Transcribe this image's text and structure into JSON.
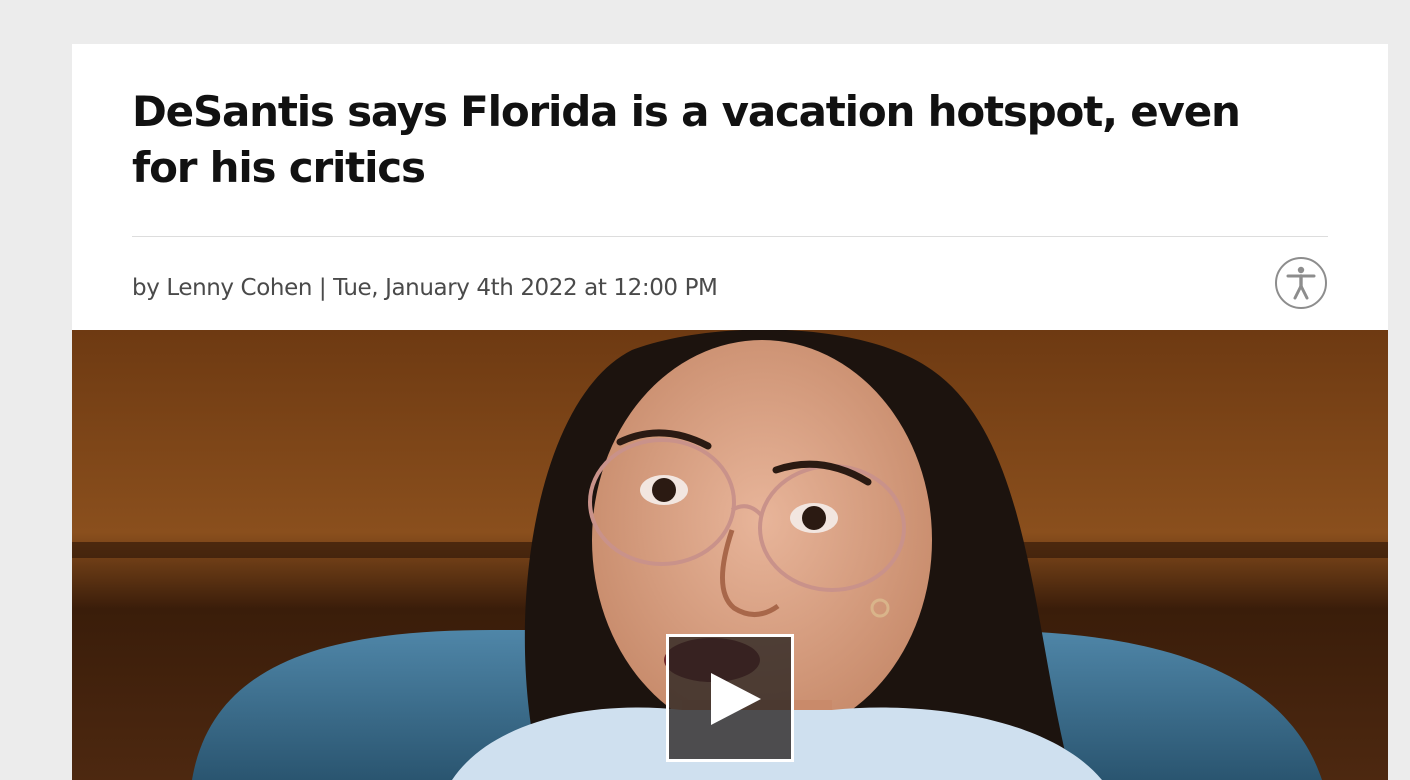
{
  "article": {
    "headline": "DeSantis says Florida is a vacation hotspot, even for his critics",
    "byline": "by Lenny Cohen | Tue, January 4th 2022 at 12:00 PM"
  },
  "icons": {
    "accessibility": "accessibility-icon",
    "play": "play-icon"
  },
  "colors": {
    "page_background": "#ececec",
    "card_background": "#ffffff",
    "headline_text": "#111111",
    "byline_text": "#4a4a4a",
    "photo_wood": "#7a4518",
    "photo_chair": "#3d6f8f"
  }
}
